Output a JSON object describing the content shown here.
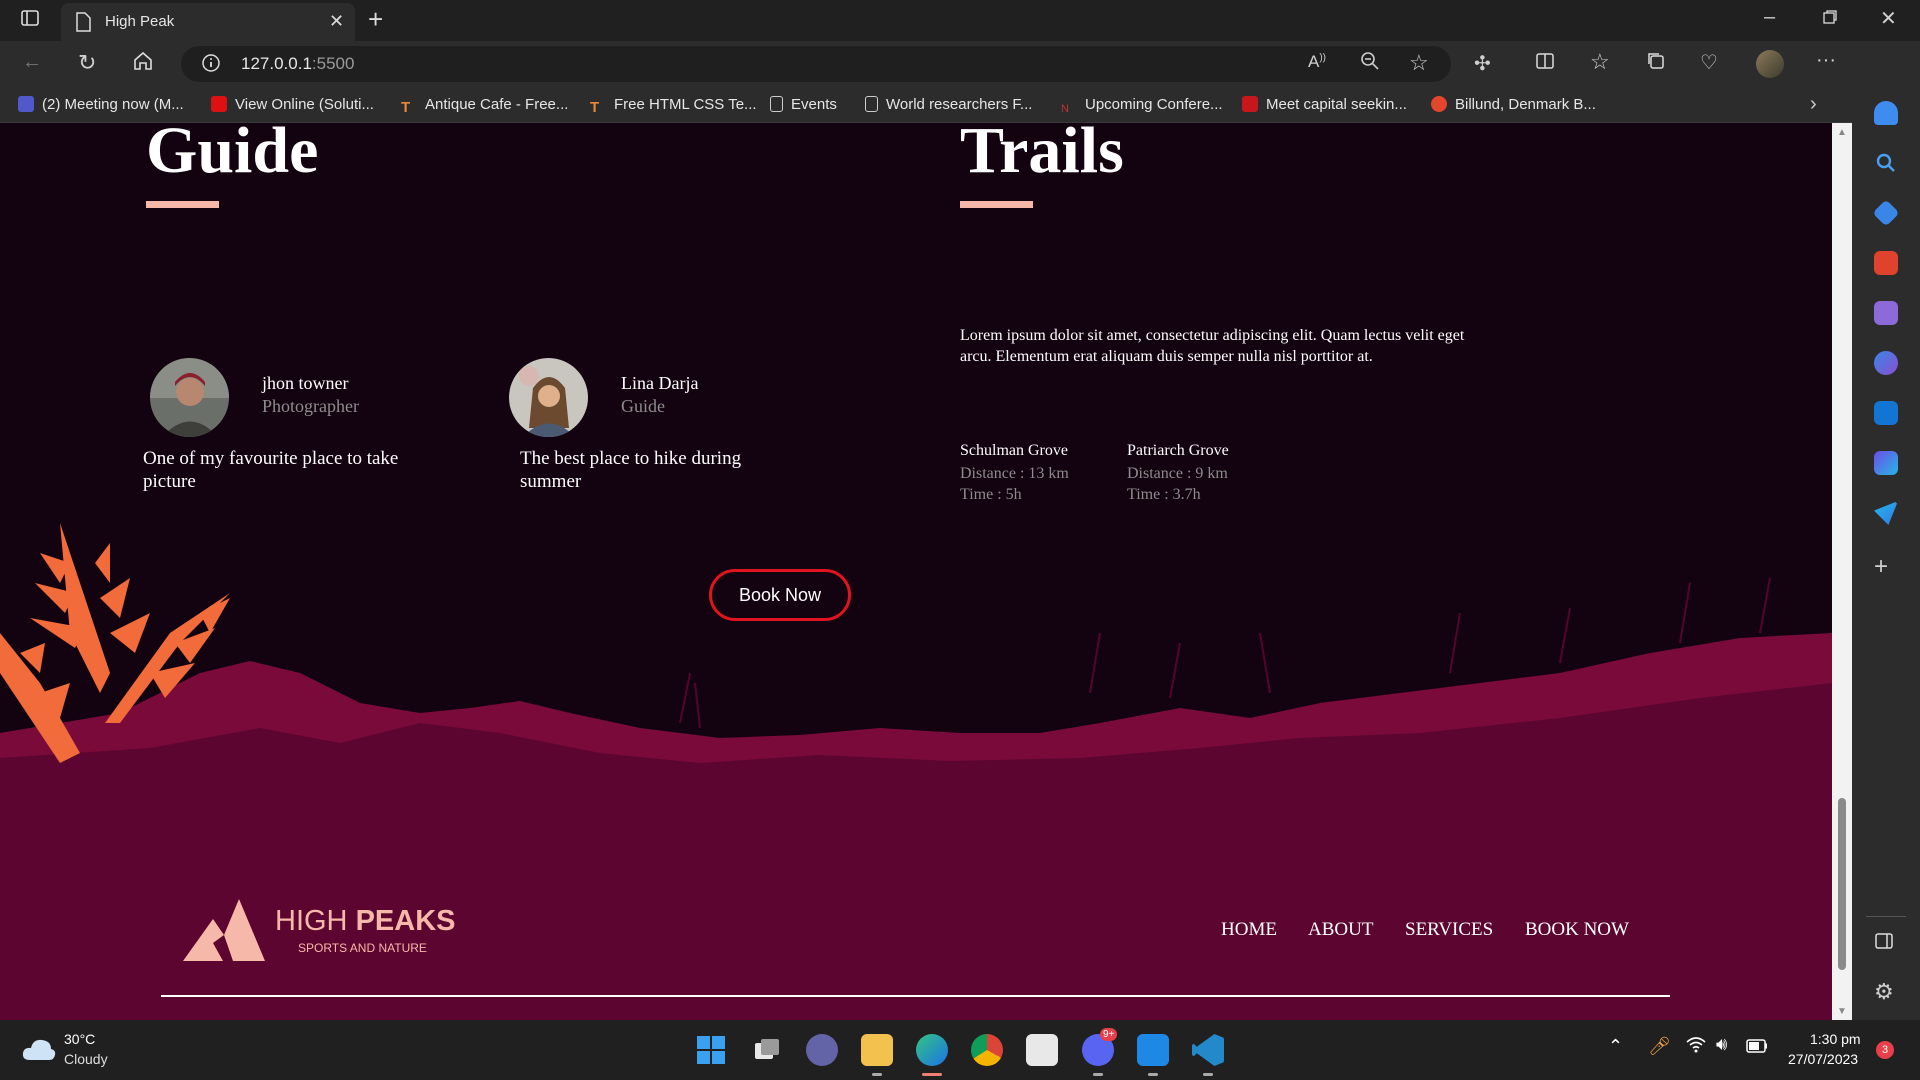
{
  "browser": {
    "tab_title": "High Peak",
    "url_host": "127.0.0.1",
    "url_port": ":5500",
    "bookmarks": [
      "(2) Meeting now (M...",
      "View Online (Soluti...",
      "Antique Cafe - Free...",
      "Free HTML CSS Te...",
      "Events",
      "World researchers F...",
      "Upcoming Confere...",
      "Meet capital seekin...",
      "Billund, Denmark B..."
    ]
  },
  "page": {
    "guide_heading": "Guide",
    "trails_heading": "Trails",
    "people": [
      {
        "name": "jhon towner",
        "role": "Photographer",
        "quote": "One of my favourite place to take picture"
      },
      {
        "name": "Lina Darja",
        "role": "Guide",
        "quote": "The best place to hike during summer"
      }
    ],
    "trails_paragraph": "Lorem ipsum dolor sit amet, consectetur adipiscing elit. Quam lectus velit eget arcu. Elementum erat aliquam duis semper nulla nisl porttitor at.",
    "trails": [
      {
        "name": "Schulman Grove",
        "distance": "Distance : 13 km",
        "time": "Time : 5h"
      },
      {
        "name": "Patriarch Grove",
        "distance": "Distance : 9 km",
        "time": "Time : 3.7h"
      }
    ],
    "book_button": "Book Now",
    "footer": {
      "logo_light": "HIGH ",
      "logo_bold": "PEAKS",
      "logo_sub": "SPORTS AND NATURE",
      "nav": [
        "HOME",
        "ABOUT",
        "SERVICES",
        "BOOK NOW"
      ]
    }
  },
  "taskbar": {
    "temperature": "30°C",
    "weather": "Cloudy",
    "time": "1:30 pm",
    "date": "27/07/2023",
    "notification_count": "3",
    "discord_badge": "9+"
  },
  "colors": {
    "page_bg": "#13020f",
    "accent_underline": "#f6b9a9",
    "book_border": "#e0141f",
    "footer_bg": "#5c0530"
  }
}
